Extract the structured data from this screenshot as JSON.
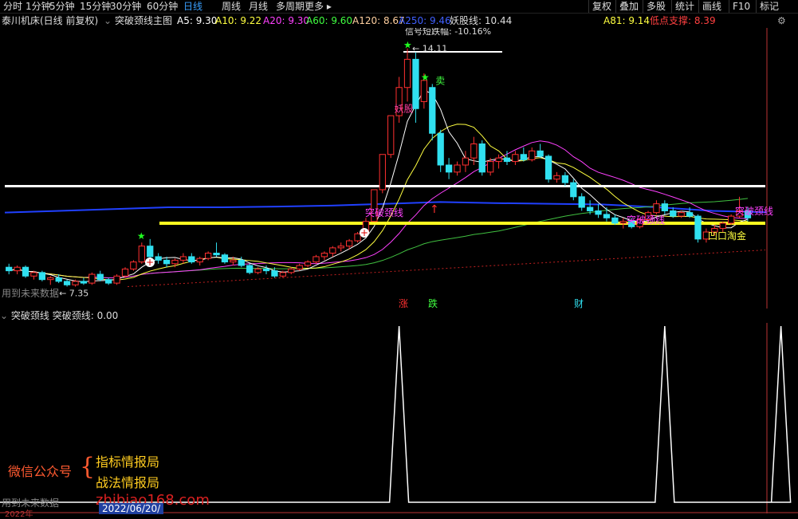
{
  "toolbar": {
    "periods": [
      "分时",
      "1分钟",
      "5分钟",
      "15分钟",
      "30分钟",
      "60分钟",
      "日线",
      "周线",
      "月线",
      "多周期",
      "更多 ▸"
    ],
    "active_period": "日线",
    "right_buttons": [
      "复权",
      "叠加",
      "多股",
      "统计",
      "画线",
      "F10",
      "标记"
    ]
  },
  "info": {
    "stock": "泰川机床(日线 前复权)",
    "indicator": "突破颈线主图",
    "ma": [
      {
        "label": "A5: 9.30",
        "color": "#ffffff"
      },
      {
        "label": "A10: 9.22",
        "color": "#ffff40"
      },
      {
        "label": "A20: 9.30",
        "color": "#ff40ff"
      },
      {
        "label": "A60: 9.60",
        "color": "#40ff40"
      },
      {
        "label": "A120: 8.67",
        "color": "#ffd0a0"
      },
      {
        "label": "A250: 9.46",
        "color": "#4060ff"
      }
    ],
    "yaogu": "妖股线: 10.44",
    "a81": "A81: 9.14",
    "support": "低点支撑: 8.39",
    "colors": {
      "a81": "#ffff40",
      "support": "#ff4040"
    }
  },
  "main_labels": {
    "top_note": "信号短跌幅: -10.16%",
    "high_price": "14.11",
    "low_price": "← 7.35",
    "sell": "卖",
    "yaogu_tag": "妖股",
    "breakout_tags": [
      "突破颈线",
      "突破颈线",
      "突破颈线"
    ],
    "taojin": "凹口淘金",
    "future_data": "用到未来数据",
    "markers": [
      "涨",
      "跌",
      "财"
    ]
  },
  "sub": {
    "title": "突破颈线",
    "value": "突破颈线: 0.00"
  },
  "watermark": {
    "account": "微信公众号",
    "brace": "{",
    "line1": "指标情报局",
    "line2": "战法情报局",
    "url": "zhibiao168.com",
    "bottom_left": "用到未来数据",
    "date": "2022/06/20/",
    "year_hint": "2022年"
  },
  "chart_data": {
    "type": "candlestick",
    "candles": [
      [
        7.9,
        8.0,
        7.7,
        7.8
      ],
      [
        7.8,
        7.95,
        7.7,
        7.9
      ],
      [
        7.9,
        7.95,
        7.6,
        7.65
      ],
      [
        7.65,
        7.8,
        7.55,
        7.75
      ],
      [
        7.75,
        7.8,
        7.5,
        7.55
      ],
      [
        7.55,
        7.65,
        7.4,
        7.6
      ],
      [
        7.6,
        7.7,
        7.45,
        7.5
      ],
      [
        7.5,
        7.55,
        7.35,
        7.4
      ],
      [
        7.4,
        7.55,
        7.35,
        7.5
      ],
      [
        7.5,
        7.6,
        7.4,
        7.45
      ],
      [
        7.45,
        7.75,
        7.4,
        7.7
      ],
      [
        7.7,
        7.8,
        7.5,
        7.55
      ],
      [
        7.55,
        7.6,
        7.4,
        7.45
      ],
      [
        7.45,
        7.7,
        7.4,
        7.65
      ],
      [
        7.65,
        7.9,
        7.6,
        7.85
      ],
      [
        7.85,
        8.1,
        7.8,
        8.05
      ],
      [
        8.05,
        8.6,
        8.0,
        8.5
      ],
      [
        8.5,
        8.7,
        8.1,
        8.2
      ],
      [
        8.2,
        8.3,
        8.0,
        8.1
      ],
      [
        8.1,
        8.2,
        7.9,
        8.0
      ],
      [
        8.0,
        8.15,
        7.9,
        8.1
      ],
      [
        8.1,
        8.3,
        8.0,
        8.2
      ],
      [
        8.2,
        8.3,
        8.0,
        8.05
      ],
      [
        8.05,
        8.2,
        7.95,
        8.15
      ],
      [
        8.15,
        8.35,
        8.1,
        8.3
      ],
      [
        8.3,
        8.6,
        8.2,
        8.25
      ],
      [
        8.25,
        8.3,
        8.0,
        8.05
      ],
      [
        8.05,
        8.2,
        7.95,
        8.1
      ],
      [
        8.1,
        8.2,
        7.9,
        7.95
      ],
      [
        7.95,
        8.0,
        7.7,
        7.75
      ],
      [
        7.75,
        7.9,
        7.7,
        7.85
      ],
      [
        7.85,
        7.95,
        7.7,
        7.8
      ],
      [
        7.8,
        7.9,
        7.6,
        7.65
      ],
      [
        7.65,
        7.8,
        7.6,
        7.75
      ],
      [
        7.75,
        7.9,
        7.7,
        7.85
      ],
      [
        7.85,
        8.0,
        7.8,
        7.95
      ],
      [
        7.95,
        8.1,
        7.9,
        8.05
      ],
      [
        8.05,
        8.25,
        8.0,
        8.2
      ],
      [
        8.2,
        8.35,
        8.1,
        8.3
      ],
      [
        8.3,
        8.5,
        8.2,
        8.45
      ],
      [
        8.45,
        8.6,
        8.35,
        8.5
      ],
      [
        8.5,
        8.7,
        8.4,
        8.65
      ],
      [
        8.65,
        8.9,
        8.6,
        8.85
      ],
      [
        8.85,
        9.3,
        8.8,
        9.2
      ],
      [
        9.2,
        10.1,
        9.2,
        10.1
      ],
      [
        10.1,
        11.1,
        10.0,
        11.1
      ],
      [
        11.1,
        12.2,
        11.0,
        12.2
      ],
      [
        12.2,
        13.3,
        12.0,
        13.0
      ],
      [
        13.0,
        14.11,
        12.6,
        13.8
      ],
      [
        13.8,
        14.0,
        12.0,
        12.4
      ],
      [
        12.6,
        13.4,
        12.4,
        13.2
      ],
      [
        13.0,
        13.1,
        11.5,
        11.7
      ],
      [
        11.7,
        11.8,
        10.6,
        10.8
      ],
      [
        10.8,
        11.0,
        10.4,
        10.6
      ],
      [
        10.6,
        10.9,
        10.5,
        10.8
      ],
      [
        10.8,
        11.2,
        10.6,
        11.0
      ],
      [
        11.0,
        11.6,
        10.8,
        11.4
      ],
      [
        11.4,
        11.5,
        10.5,
        10.6
      ],
      [
        10.6,
        11.0,
        10.5,
        10.9
      ],
      [
        10.9,
        11.1,
        10.7,
        11.0
      ],
      [
        11.0,
        11.2,
        10.8,
        10.9
      ],
      [
        10.9,
        11.2,
        10.8,
        11.1
      ],
      [
        11.1,
        11.3,
        10.9,
        10.95
      ],
      [
        10.95,
        11.3,
        10.9,
        11.2
      ],
      [
        11.2,
        11.4,
        11.0,
        11.05
      ],
      [
        11.05,
        11.1,
        10.3,
        10.4
      ],
      [
        10.4,
        10.6,
        10.3,
        10.5
      ],
      [
        10.5,
        10.6,
        10.2,
        10.3
      ],
      [
        10.3,
        10.4,
        9.8,
        9.9
      ],
      [
        9.9,
        10.0,
        9.5,
        9.6
      ],
      [
        9.6,
        9.8,
        9.4,
        9.5
      ],
      [
        9.5,
        9.7,
        9.3,
        9.4
      ],
      [
        9.4,
        9.6,
        9.2,
        9.3
      ],
      [
        9.3,
        9.4,
        9.1,
        9.15
      ],
      [
        9.15,
        9.3,
        9.0,
        9.2
      ],
      [
        9.2,
        9.3,
        9.0,
        9.05
      ],
      [
        9.05,
        9.3,
        9.0,
        9.25
      ],
      [
        9.25,
        9.5,
        9.2,
        9.45
      ],
      [
        9.45,
        9.8,
        9.4,
        9.7
      ],
      [
        9.7,
        9.8,
        9.4,
        9.5
      ],
      [
        9.5,
        9.6,
        9.3,
        9.35
      ],
      [
        9.35,
        9.5,
        9.3,
        9.45
      ],
      [
        9.45,
        9.6,
        9.3,
        9.35
      ],
      [
        9.35,
        9.4,
        8.6,
        8.7
      ],
      [
        8.7,
        9.0,
        8.6,
        8.9
      ],
      [
        8.9,
        9.1,
        8.8,
        9.0
      ],
      [
        9.0,
        9.2,
        8.9,
        9.15
      ],
      [
        9.15,
        9.4,
        9.1,
        9.35
      ],
      [
        9.35,
        9.9,
        9.3,
        9.5
      ],
      [
        9.5,
        9.6,
        9.2,
        9.3
      ]
    ],
    "lines": {
      "neckline_white": 10.2,
      "neckline_yellow": 9.15,
      "blue_a250": [
        9.45,
        9.5,
        9.55,
        9.6,
        9.6,
        9.62,
        9.65,
        9.7,
        9.75,
        9.72,
        9.7,
        9.68,
        9.6,
        9.5,
        9.46
      ],
      "sub_spikes": [
        47,
        79,
        93
      ]
    },
    "ylim": [
      7.0,
      14.6
    ],
    "sub_ylim": [
      0,
      1
    ]
  }
}
